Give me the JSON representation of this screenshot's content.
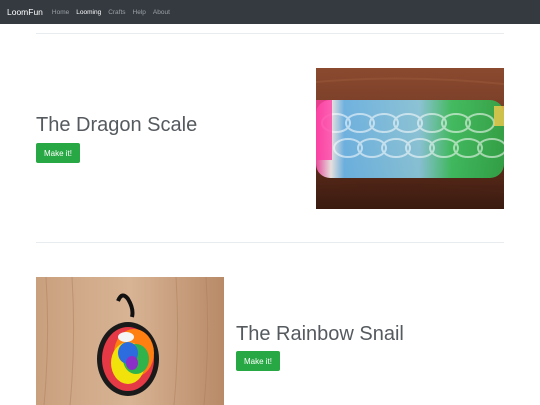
{
  "navbar": {
    "brand": "LoomFun",
    "links": [
      {
        "label": "Home",
        "active": false
      },
      {
        "label": "Looming",
        "active": true
      },
      {
        "label": "Crafts",
        "active": false
      },
      {
        "label": "Help",
        "active": false
      },
      {
        "label": "About",
        "active": false
      }
    ]
  },
  "crafts": [
    {
      "title": "The Dragon Scale",
      "button_label": "Make it!",
      "image_icon": "rubber-band-bracelet-photo"
    },
    {
      "title": "The Rainbow Snail",
      "button_label": "Make it!",
      "image_icon": "rubber-band-snail-photo"
    }
  ],
  "colors": {
    "navbar_bg": "#343a40",
    "button_green": "#28a745",
    "heading_text": "#555a5f"
  }
}
